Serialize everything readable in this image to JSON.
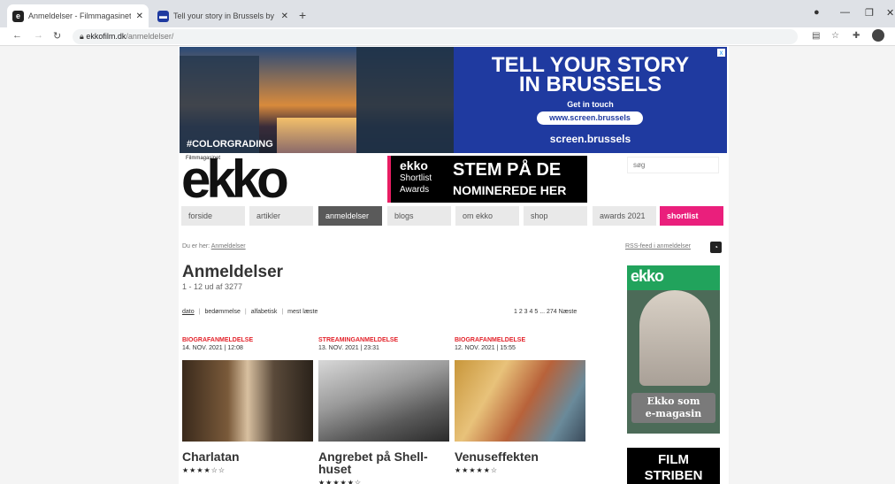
{
  "browser": {
    "tabs": [
      {
        "title": "Anmeldelser - Filmmagasinet Ek",
        "icon": "e"
      },
      {
        "title": "Tell your story in Brussels by scr",
        "icon": "▬"
      }
    ],
    "new_tab": "+",
    "address_host": "ekkofilm.dk",
    "address_path": "/anmeldelser/"
  },
  "banner": {
    "tag": "#COLORGRADING",
    "headline_1": "TELL YOUR STORY",
    "headline_2": "IN BRUSSELS",
    "sub": "Get in touch",
    "url": "www.screen.brussels",
    "brand": "screen.brussels"
  },
  "logo": {
    "small": "Filmmagasinet",
    "name": "ekko"
  },
  "ad_shortlist": {
    "brand": "ekko",
    "line1": "Shortlist",
    "line2": "Awards",
    "cta1": "STEM PÅ DE",
    "cta2": "NOMINEREDE HER"
  },
  "search": {
    "placeholder": "søg"
  },
  "nav": [
    "forside",
    "artikler",
    "anmeldelser",
    "blogs",
    "om ekko",
    "shop",
    "awards 2021",
    "shortlist"
  ],
  "crumb": {
    "prefix": "Du er her:",
    "link": "Anmeldelser"
  },
  "rss": {
    "label": "RSS-feed i anmeldelser"
  },
  "heading": "Anmeldelser",
  "count": "1 - 12 ud af 3277",
  "sort": [
    "dato",
    "bedømmelse",
    "alfabetisk",
    "mest læste"
  ],
  "pagination": "1 2 3 4 5 ... 274 Næste",
  "cards": [
    {
      "label": "BIOGRAFANMELDELSE",
      "date": "14. NOV. 2021 | 12:08",
      "title": "Charlatan",
      "stars": "★★★★☆☆"
    },
    {
      "label": "STREAMINGANMELDELSE",
      "date": "13. NOV. 2021 | 23:31",
      "title": "Angrebet på Shell-huset",
      "stars": "★★★★★☆"
    },
    {
      "label": "BIOGRAFANMELDELSE",
      "date": "12. NOV. 2021 | 15:55",
      "title": "Venuseffekten",
      "stars": "★★★★★☆"
    }
  ],
  "magazine": {
    "logo": "ekko",
    "button_1": "Ekko som",
    "button_2": "e-magasin"
  },
  "ad_film": {
    "line1": "FILM",
    "line2": "STRIBEN"
  }
}
